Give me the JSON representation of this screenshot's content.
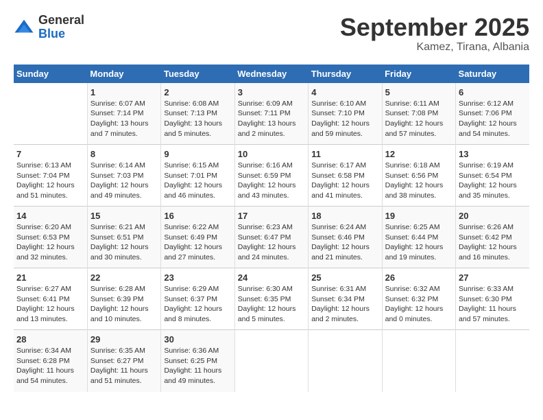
{
  "header": {
    "logo_general": "General",
    "logo_blue": "Blue",
    "month_title": "September 2025",
    "location": "Kamez, Tirana, Albania"
  },
  "days_of_week": [
    "Sunday",
    "Monday",
    "Tuesday",
    "Wednesday",
    "Thursday",
    "Friday",
    "Saturday"
  ],
  "weeks": [
    [
      {
        "day": "",
        "info": ""
      },
      {
        "day": "1",
        "info": "Sunrise: 6:07 AM\nSunset: 7:14 PM\nDaylight: 13 hours\nand 7 minutes."
      },
      {
        "day": "2",
        "info": "Sunrise: 6:08 AM\nSunset: 7:13 PM\nDaylight: 13 hours\nand 5 minutes."
      },
      {
        "day": "3",
        "info": "Sunrise: 6:09 AM\nSunset: 7:11 PM\nDaylight: 13 hours\nand 2 minutes."
      },
      {
        "day": "4",
        "info": "Sunrise: 6:10 AM\nSunset: 7:10 PM\nDaylight: 12 hours\nand 59 minutes."
      },
      {
        "day": "5",
        "info": "Sunrise: 6:11 AM\nSunset: 7:08 PM\nDaylight: 12 hours\nand 57 minutes."
      },
      {
        "day": "6",
        "info": "Sunrise: 6:12 AM\nSunset: 7:06 PM\nDaylight: 12 hours\nand 54 minutes."
      }
    ],
    [
      {
        "day": "7",
        "info": "Sunrise: 6:13 AM\nSunset: 7:04 PM\nDaylight: 12 hours\nand 51 minutes."
      },
      {
        "day": "8",
        "info": "Sunrise: 6:14 AM\nSunset: 7:03 PM\nDaylight: 12 hours\nand 49 minutes."
      },
      {
        "day": "9",
        "info": "Sunrise: 6:15 AM\nSunset: 7:01 PM\nDaylight: 12 hours\nand 46 minutes."
      },
      {
        "day": "10",
        "info": "Sunrise: 6:16 AM\nSunset: 6:59 PM\nDaylight: 12 hours\nand 43 minutes."
      },
      {
        "day": "11",
        "info": "Sunrise: 6:17 AM\nSunset: 6:58 PM\nDaylight: 12 hours\nand 41 minutes."
      },
      {
        "day": "12",
        "info": "Sunrise: 6:18 AM\nSunset: 6:56 PM\nDaylight: 12 hours\nand 38 minutes."
      },
      {
        "day": "13",
        "info": "Sunrise: 6:19 AM\nSunset: 6:54 PM\nDaylight: 12 hours\nand 35 minutes."
      }
    ],
    [
      {
        "day": "14",
        "info": "Sunrise: 6:20 AM\nSunset: 6:53 PM\nDaylight: 12 hours\nand 32 minutes."
      },
      {
        "day": "15",
        "info": "Sunrise: 6:21 AM\nSunset: 6:51 PM\nDaylight: 12 hours\nand 30 minutes."
      },
      {
        "day": "16",
        "info": "Sunrise: 6:22 AM\nSunset: 6:49 PM\nDaylight: 12 hours\nand 27 minutes."
      },
      {
        "day": "17",
        "info": "Sunrise: 6:23 AM\nSunset: 6:47 PM\nDaylight: 12 hours\nand 24 minutes."
      },
      {
        "day": "18",
        "info": "Sunrise: 6:24 AM\nSunset: 6:46 PM\nDaylight: 12 hours\nand 21 minutes."
      },
      {
        "day": "19",
        "info": "Sunrise: 6:25 AM\nSunset: 6:44 PM\nDaylight: 12 hours\nand 19 minutes."
      },
      {
        "day": "20",
        "info": "Sunrise: 6:26 AM\nSunset: 6:42 PM\nDaylight: 12 hours\nand 16 minutes."
      }
    ],
    [
      {
        "day": "21",
        "info": "Sunrise: 6:27 AM\nSunset: 6:41 PM\nDaylight: 12 hours\nand 13 minutes."
      },
      {
        "day": "22",
        "info": "Sunrise: 6:28 AM\nSunset: 6:39 PM\nDaylight: 12 hours\nand 10 minutes."
      },
      {
        "day": "23",
        "info": "Sunrise: 6:29 AM\nSunset: 6:37 PM\nDaylight: 12 hours\nand 8 minutes."
      },
      {
        "day": "24",
        "info": "Sunrise: 6:30 AM\nSunset: 6:35 PM\nDaylight: 12 hours\nand 5 minutes."
      },
      {
        "day": "25",
        "info": "Sunrise: 6:31 AM\nSunset: 6:34 PM\nDaylight: 12 hours\nand 2 minutes."
      },
      {
        "day": "26",
        "info": "Sunrise: 6:32 AM\nSunset: 6:32 PM\nDaylight: 12 hours\nand 0 minutes."
      },
      {
        "day": "27",
        "info": "Sunrise: 6:33 AM\nSunset: 6:30 PM\nDaylight: 11 hours\nand 57 minutes."
      }
    ],
    [
      {
        "day": "28",
        "info": "Sunrise: 6:34 AM\nSunset: 6:28 PM\nDaylight: 11 hours\nand 54 minutes."
      },
      {
        "day": "29",
        "info": "Sunrise: 6:35 AM\nSunset: 6:27 PM\nDaylight: 11 hours\nand 51 minutes."
      },
      {
        "day": "30",
        "info": "Sunrise: 6:36 AM\nSunset: 6:25 PM\nDaylight: 11 hours\nand 49 minutes."
      },
      {
        "day": "",
        "info": ""
      },
      {
        "day": "",
        "info": ""
      },
      {
        "day": "",
        "info": ""
      },
      {
        "day": "",
        "info": ""
      }
    ]
  ]
}
